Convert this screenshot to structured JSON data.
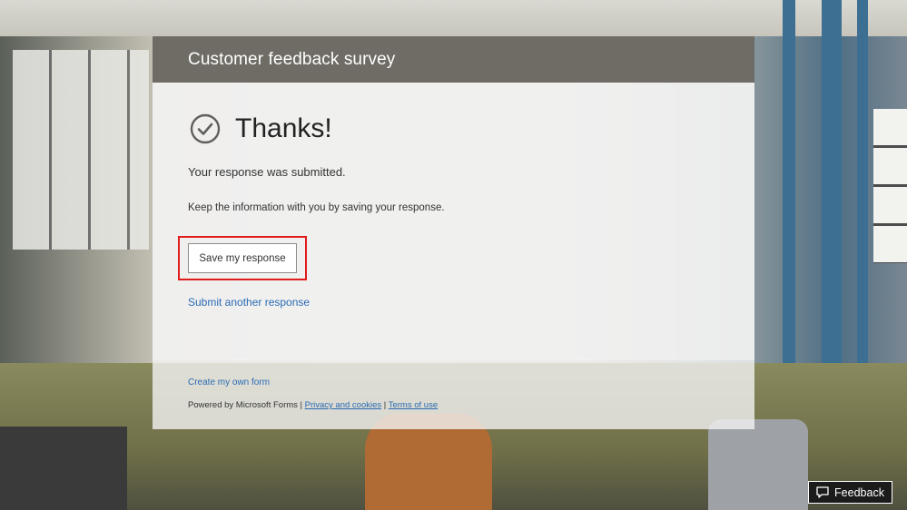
{
  "survey": {
    "title": "Customer feedback survey"
  },
  "confirmation": {
    "heading": "Thanks!",
    "submitted_text": "Your response was submitted.",
    "keep_info_text": "Keep the information with you by saving your response.",
    "save_button_label": "Save my response",
    "submit_another_label": "Submit another response",
    "icon": "check-circle-icon"
  },
  "footer": {
    "create_form_label": "Create my own form",
    "powered_by_text": "Powered by Microsoft Forms |",
    "privacy_label": "Privacy and cookies",
    "separator": "|",
    "terms_label": "Terms of use"
  },
  "feedback_button": {
    "label": "Feedback",
    "icon": "comment-icon"
  },
  "colors": {
    "header_bg": "#6e6c64",
    "link": "#2a6ab3",
    "highlight": "#e11b1b",
    "feedback_bg": "#1b1b1b"
  }
}
